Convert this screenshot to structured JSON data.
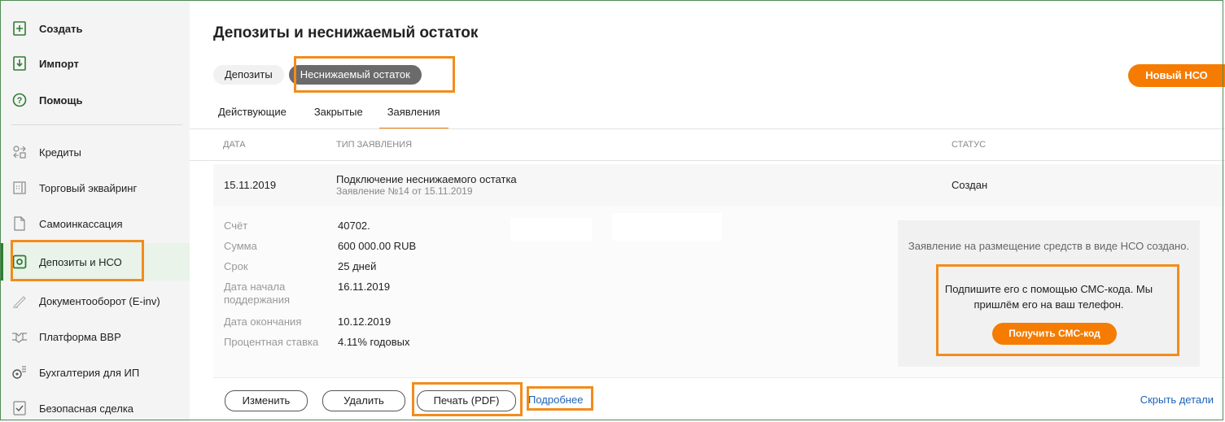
{
  "sidebar": {
    "top_items": [
      {
        "label": "Создать",
        "icon": "plus-doc-icon"
      },
      {
        "label": "Импорт",
        "icon": "download-doc-icon"
      },
      {
        "label": "Помощь",
        "icon": "help-icon"
      }
    ],
    "items": [
      {
        "label": "Кредиты",
        "icon": "transfer-icon"
      },
      {
        "label": "Торговый эквайринг",
        "icon": "pos-terminal-icon"
      },
      {
        "label": "Самоинкассация",
        "icon": "document-icon"
      },
      {
        "label": "Депозиты и НСО",
        "icon": "safe-icon"
      },
      {
        "label": "Документооборот (E-inv)",
        "icon": "signature-icon"
      },
      {
        "label": "Платформа ВВР",
        "icon": "handshake-icon"
      },
      {
        "label": "Бухгалтерия для ИП",
        "icon": "accounting-icon"
      },
      {
        "label": "Безопасная сделка",
        "icon": "check-doc-icon"
      }
    ]
  },
  "main": {
    "title": "Депозиты и неснижаемый остаток",
    "segments": [
      "Депозиты",
      "Неснижаемый остаток"
    ],
    "new_button": "Новый НСО",
    "tabs": [
      "Действующие",
      "Закрытые",
      "Заявления"
    ],
    "table_headers": {
      "date": "ДАТА",
      "type": "ТИП ЗАЯВЛЕНИЯ",
      "status": "СТАТУС"
    },
    "row": {
      "date": "15.11.2019",
      "type_title": "Подключение неснижаемого остатка",
      "type_sub": "Заявление №14 от 15.11.2019",
      "status": "Создан"
    },
    "details": [
      {
        "label": "Счёт",
        "value": "40702."
      },
      {
        "label": "Сумма",
        "value": "600 000.00 RUB"
      },
      {
        "label": "Срок",
        "value": "25 дней"
      },
      {
        "label": "Дата начала поддержания",
        "value": "16.11.2019"
      },
      {
        "label": "Дата окончания",
        "value": "10.12.2019"
      },
      {
        "label": "Процентная ставка",
        "value": "4.11% годовых"
      }
    ],
    "sms_panel": {
      "info": "Заявление на размещение средств в виде НСО создано.",
      "instruction": "Подпишите его с помощью СМС-кода. Мы пришлём его на ваш телефон.",
      "button": "Получить СМС-код"
    },
    "footer": {
      "edit": "Изменить",
      "delete": "Удалить",
      "print": "Печать (PDF)",
      "more": "Подробнее",
      "hide": "Скрыть детали"
    }
  },
  "colors": {
    "accent": "#f57c00",
    "highlight": "#f28c1c",
    "active_green": "#2e7d32",
    "link": "#1e62b8"
  }
}
